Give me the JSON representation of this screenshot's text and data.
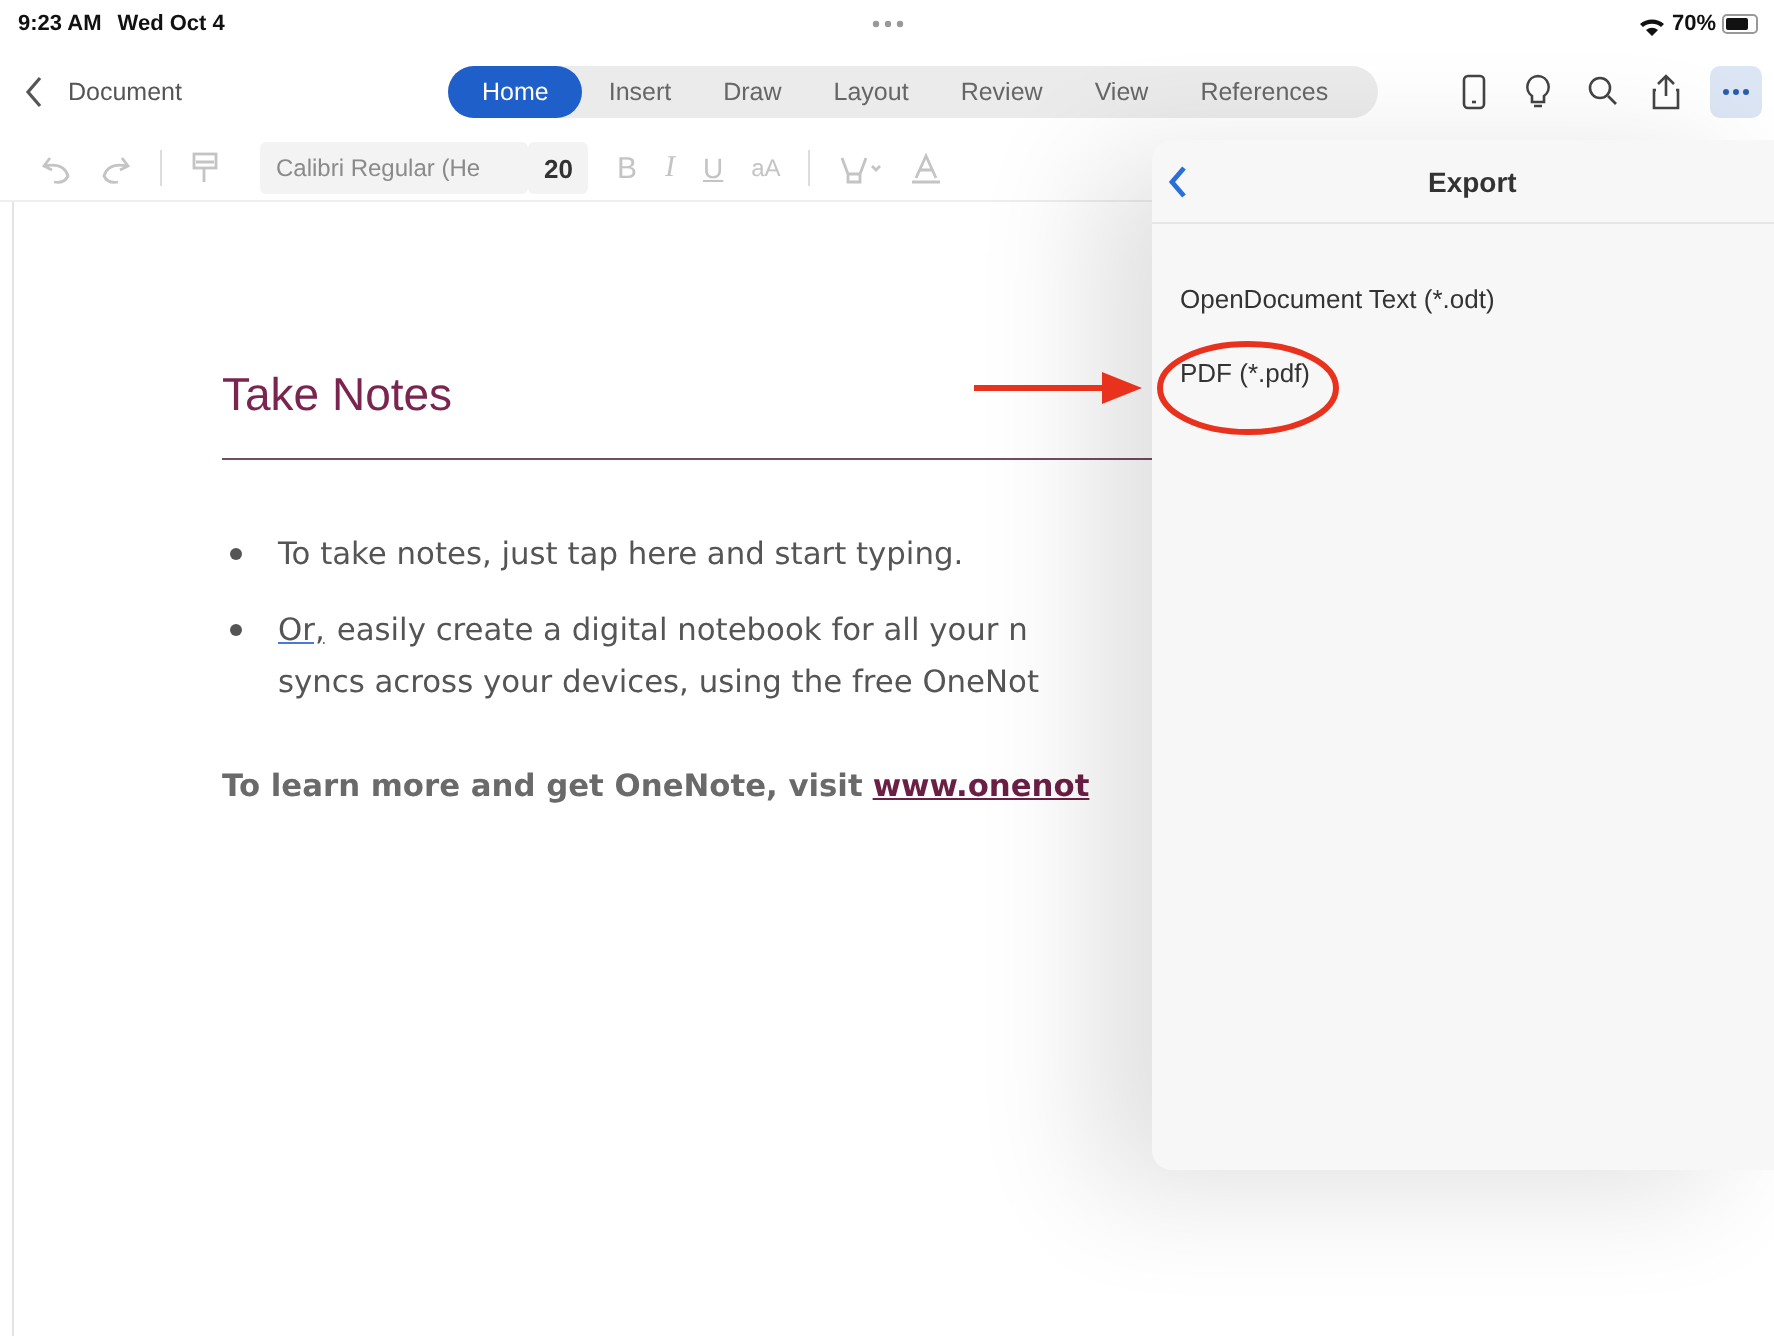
{
  "status_bar": {
    "time": "9:23 AM",
    "date": "Wed Oct 4",
    "battery": "70%"
  },
  "nav": {
    "title": "Document",
    "tabs": [
      {
        "label": "Home",
        "selected": true
      },
      {
        "label": "Insert",
        "selected": false
      },
      {
        "label": "Draw",
        "selected": false
      },
      {
        "label": "Layout",
        "selected": false
      },
      {
        "label": "Review",
        "selected": false
      },
      {
        "label": "View",
        "selected": false
      },
      {
        "label": "References",
        "selected": false
      }
    ]
  },
  "toolbar": {
    "font": "Calibri Regular (He",
    "size": "20",
    "bold": "B",
    "italic": "I",
    "underline": "U",
    "font_size_menu": "aA"
  },
  "document": {
    "heading": "Take Notes",
    "bullets": [
      {
        "lines": [
          "To take notes, just tap here and start typing."
        ]
      },
      {
        "flagged": "Or,",
        "lines": [
          "easily create a digital notebook for all your n",
          "syncs across your devices, using the free OneNot"
        ]
      }
    ],
    "footer": {
      "text": "To learn more and get OneNote, visit",
      "link": "www.onenot"
    }
  },
  "export_panel": {
    "title": "Export",
    "options": [
      "OpenDocument Text (*.odt)",
      "PDF (*.pdf)"
    ]
  }
}
